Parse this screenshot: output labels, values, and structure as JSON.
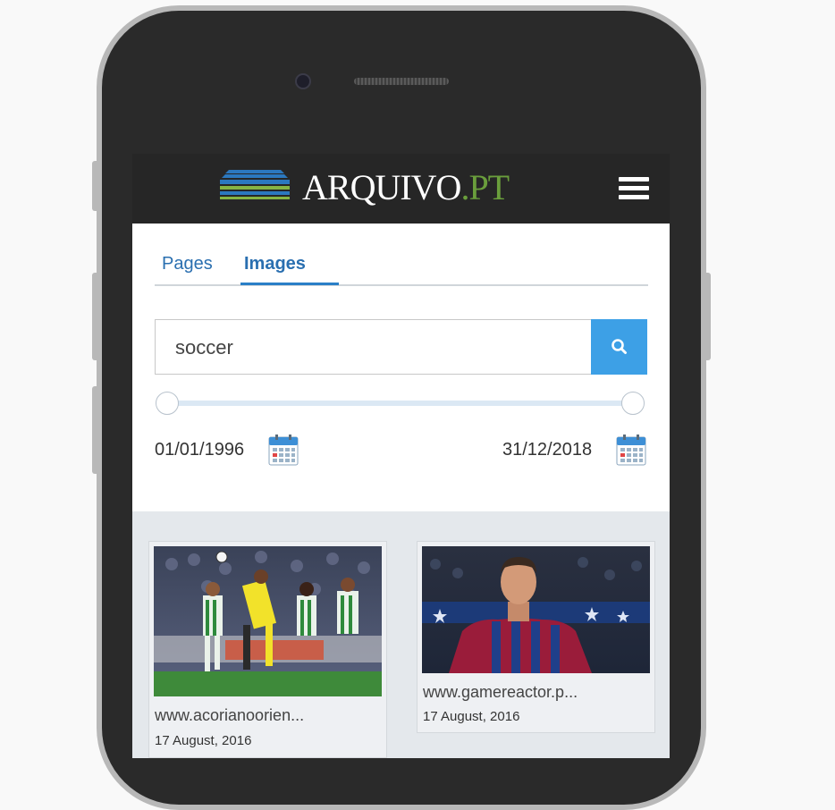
{
  "app": {
    "logo_text_main": "ARQUIVO",
    "logo_text_accent": ".PT"
  },
  "tabs": [
    {
      "label": "Pages",
      "active": false
    },
    {
      "label": "Images",
      "active": true
    }
  ],
  "search": {
    "value": "soccer"
  },
  "date_range": {
    "from": "01/01/1996",
    "to": "31/12/2018"
  },
  "results": [
    {
      "site": "www.acorianoorien...",
      "date": "17 August, 2016"
    },
    {
      "site": "www.gamereactor.p...",
      "date": "17 August, 2016"
    }
  ],
  "colors": {
    "accent": "#3da0e6",
    "header_bg": "#262626",
    "logo_accent": "#6a9e3c"
  }
}
